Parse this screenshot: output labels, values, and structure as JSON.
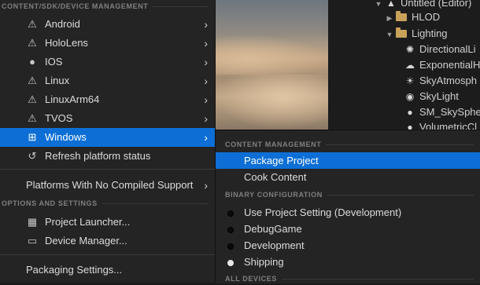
{
  "outliner": {
    "items": [
      {
        "label": "Untitled (Editor)",
        "icon": "level-icon"
      },
      {
        "label": "HLOD",
        "icon": "folder-icon"
      },
      {
        "label": "Lighting",
        "icon": "folder-open-icon"
      },
      {
        "label": "DirectionalLi",
        "icon": "directional-light-icon"
      },
      {
        "label": "ExponentialH",
        "icon": "exponential-fog-icon"
      },
      {
        "label": "SkyAtmosph",
        "icon": "sky-atmosphere-icon"
      },
      {
        "label": "SkyLight",
        "icon": "skylight-icon"
      },
      {
        "label": "SM_SkySphe",
        "icon": "static-mesh-icon"
      },
      {
        "label": "VolumetricCl",
        "icon": "volumetric-cloud-icon"
      }
    ]
  },
  "left_menu": {
    "section_content": "CONTENT/SDK/DEVICE MANAGEMENT",
    "platforms": [
      {
        "label": "Android",
        "icon": "warning-icon"
      },
      {
        "label": "HoloLens",
        "icon": "warning-icon"
      },
      {
        "label": "IOS",
        "icon": "apple-icon"
      },
      {
        "label": "Linux",
        "icon": "warning-icon"
      },
      {
        "label": "LinuxArm64",
        "icon": "warning-icon"
      },
      {
        "label": "TVOS",
        "icon": "warning-icon"
      },
      {
        "label": "Windows",
        "icon": "windows-icon"
      }
    ],
    "refresh": "Refresh platform status",
    "no_compiled": "Platforms With No Compiled Support",
    "section_options": "OPTIONS AND SETTINGS",
    "project_launcher": "Project Launcher...",
    "device_manager": "Device Manager...",
    "packaging_settings": "Packaging Settings..."
  },
  "right_menu": {
    "section_content": "CONTENT MANAGEMENT",
    "package_project": "Package Project",
    "cook_content": "Cook Content",
    "section_binary": "BINARY CONFIGURATION",
    "configs": [
      {
        "label": "Use Project Setting (Development)",
        "selected": false
      },
      {
        "label": "DebugGame",
        "selected": false
      },
      {
        "label": "Development",
        "selected": false
      },
      {
        "label": "Shipping",
        "selected": true
      }
    ],
    "section_devices": "ALL DEVICES"
  },
  "colors": {
    "accent": "#0d6fd6",
    "menu_bg": "#242424"
  }
}
